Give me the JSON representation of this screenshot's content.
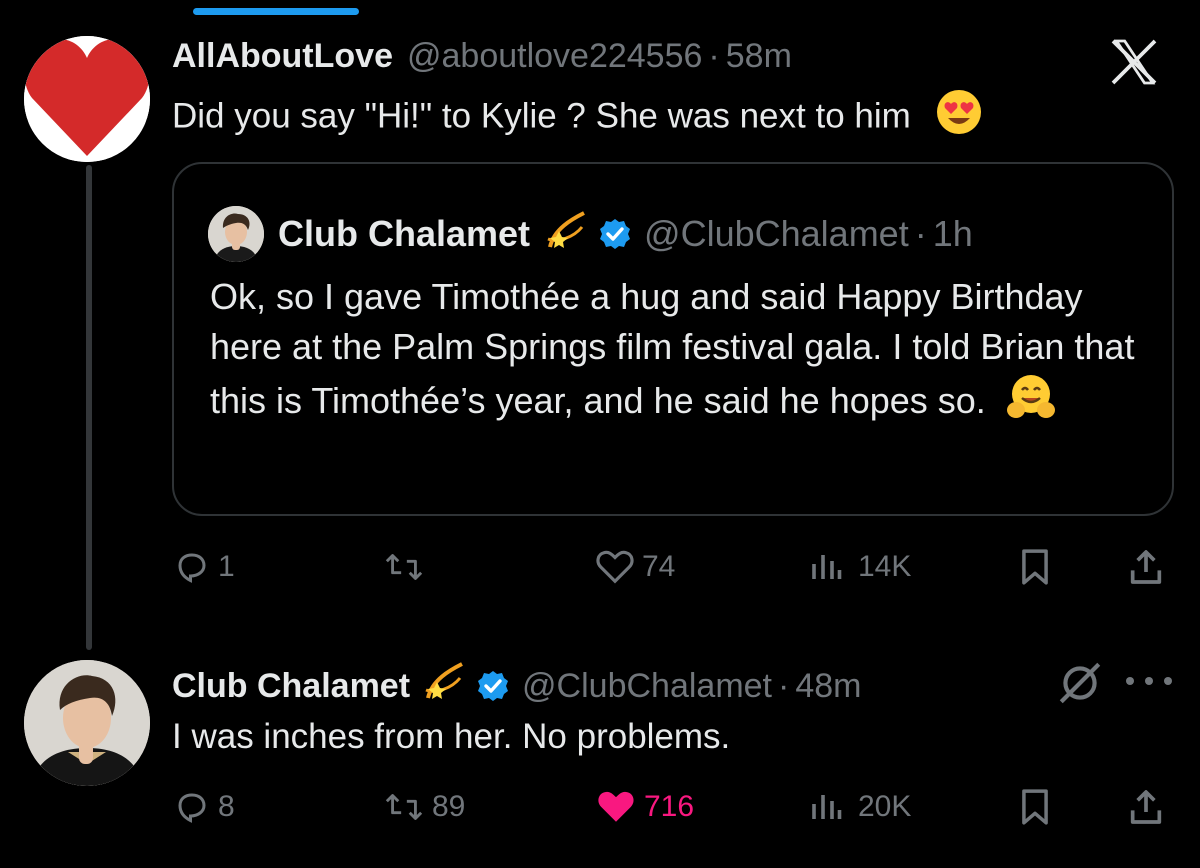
{
  "reply": {
    "author_name": "AllAboutLove",
    "author_handle": "@aboutlove224556",
    "separator": "·",
    "time": "58m",
    "text": "Did you say \"Hi!\" to Kylie ? She was next to him",
    "emoji": "smiling-face-with-heart-eyes"
  },
  "quoted": {
    "author_name": "Club Chalamet",
    "author_handle": "@ClubChalamet",
    "separator": "·",
    "time": "1h",
    "text": "Ok, so I gave Timothée a hug and said Happy Birthday here at the Palm Springs film festival gala. I told Brian that this is Timothée’s year, and he said he hopes so.",
    "emoji": "hugging-face"
  },
  "reply_actions": {
    "replies": "1",
    "reposts": "",
    "likes": "74",
    "views": "14K"
  },
  "response": {
    "author_name": "Club Chalamet",
    "author_handle": "@ClubChalamet",
    "separator": "·",
    "time": "48m",
    "text": "I was inches from her. No problems."
  },
  "response_actions": {
    "replies": "8",
    "reposts": "89",
    "likes": "716",
    "views": "20K"
  },
  "colors": {
    "background": "#000000",
    "text": "#e7e9ea",
    "muted": "#71767b",
    "like_active": "#f91880",
    "verified": "#1d9bf0",
    "avatar_heart": "#d42a2a"
  },
  "icons": [
    "x-logo-icon",
    "reply-icon",
    "repost-icon",
    "like-icon",
    "views-icon",
    "bookmark-icon",
    "share-icon",
    "verified-badge-icon",
    "dizzy-emoji-icon",
    "grok-icon",
    "more-icon"
  ]
}
